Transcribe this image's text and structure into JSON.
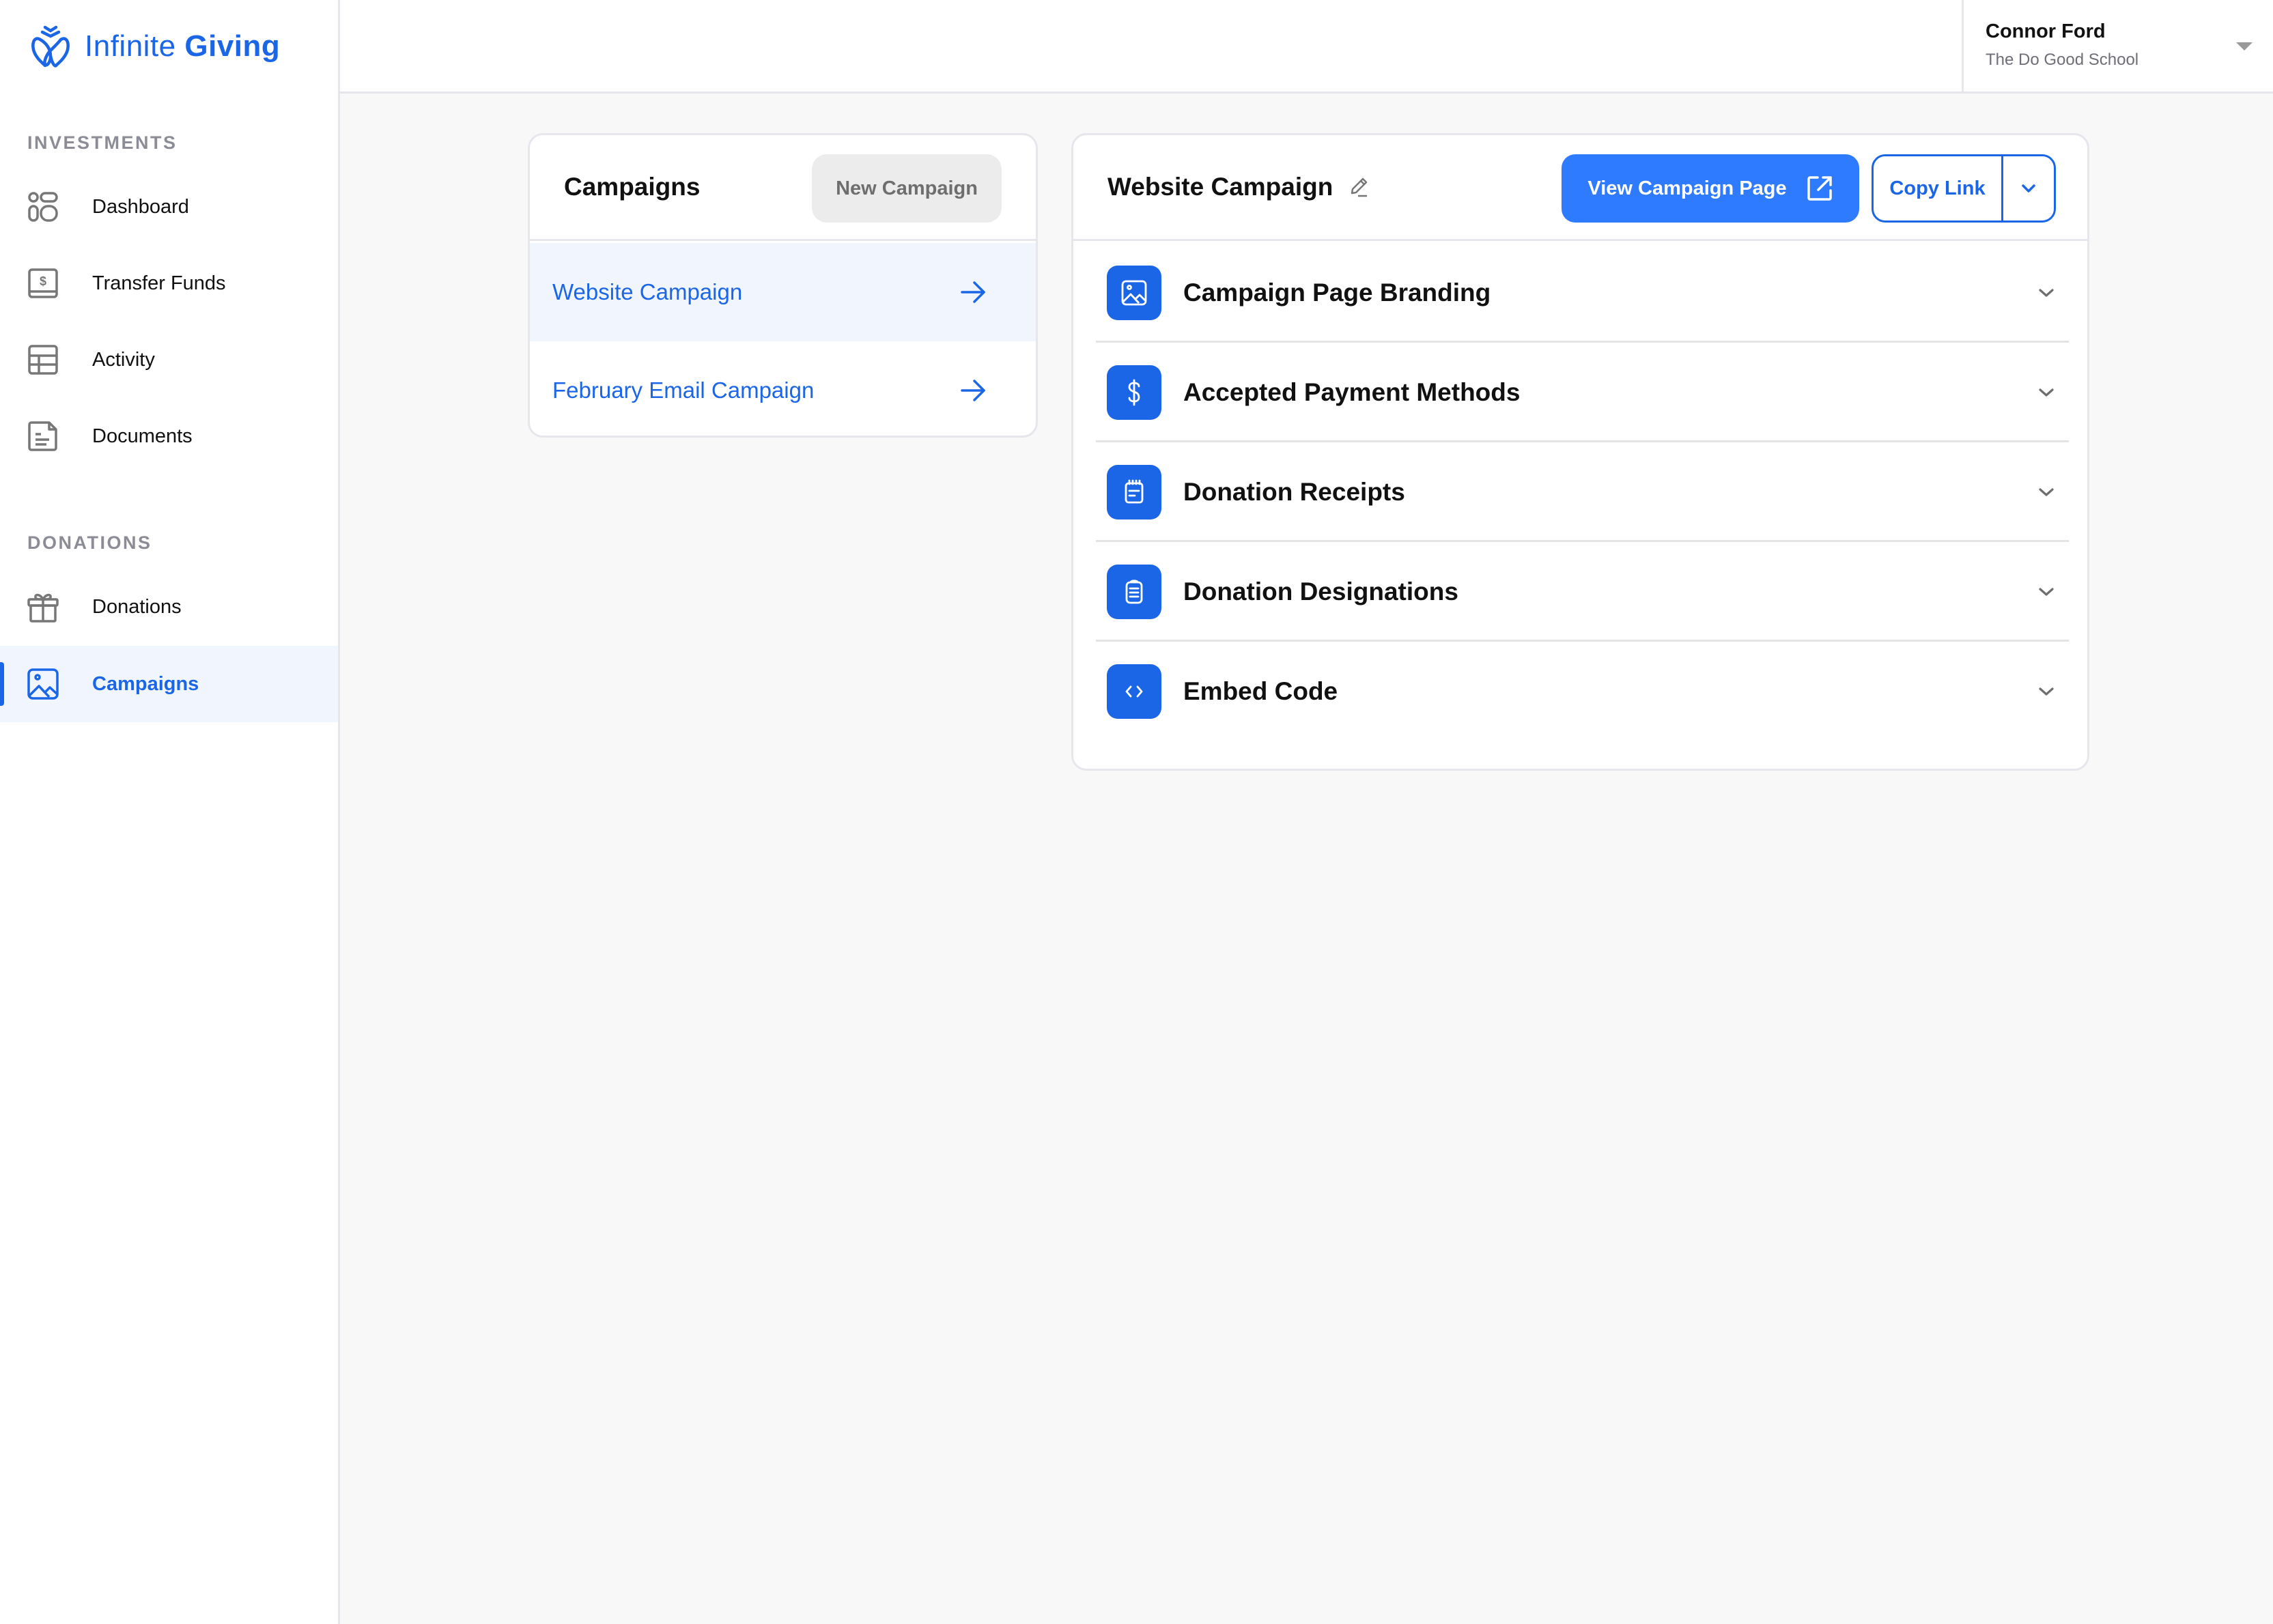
{
  "brand": {
    "name_light": "Infinite",
    "name_bold": "Giving",
    "color": "#1a66e6"
  },
  "sidebar": {
    "sections": [
      {
        "label": "INVESTMENTS",
        "items": [
          {
            "label": "Dashboard",
            "icon": "dashboard-icon"
          },
          {
            "label": "Transfer Funds",
            "icon": "transfer-funds-icon"
          },
          {
            "label": "Activity",
            "icon": "table-icon"
          },
          {
            "label": "Documents",
            "icon": "document-icon"
          }
        ]
      },
      {
        "label": "DONATIONS",
        "items": [
          {
            "label": "Donations",
            "icon": "gift-icon"
          },
          {
            "label": "Campaigns",
            "icon": "image-icon",
            "active": true
          }
        ]
      }
    ]
  },
  "user": {
    "name": "Connor Ford",
    "organization": "The Do Good School"
  },
  "campaigns_panel": {
    "title": "Campaigns",
    "new_button": "New Campaign",
    "items": [
      {
        "name": "Website Campaign",
        "selected": true
      },
      {
        "name": "February Email Campaign",
        "selected": false
      }
    ]
  },
  "detail_panel": {
    "title": "Website Campaign",
    "view_button": "View Campaign Page",
    "copy_button": "Copy Link",
    "sections": [
      {
        "label": "Campaign Page Branding",
        "icon": "image-icon"
      },
      {
        "label": "Accepted Payment Methods",
        "icon": "dollar-icon"
      },
      {
        "label": "Donation Receipts",
        "icon": "receipt-icon"
      },
      {
        "label": "Donation Designations",
        "icon": "clipboard-icon"
      },
      {
        "label": "Embed Code",
        "icon": "code-icon"
      }
    ]
  },
  "colors": {
    "accent": "#1a66e6",
    "primary_button": "#2f7bff",
    "selected_bg": "#f1f6fe",
    "page_bg": "#f8f8f8"
  }
}
